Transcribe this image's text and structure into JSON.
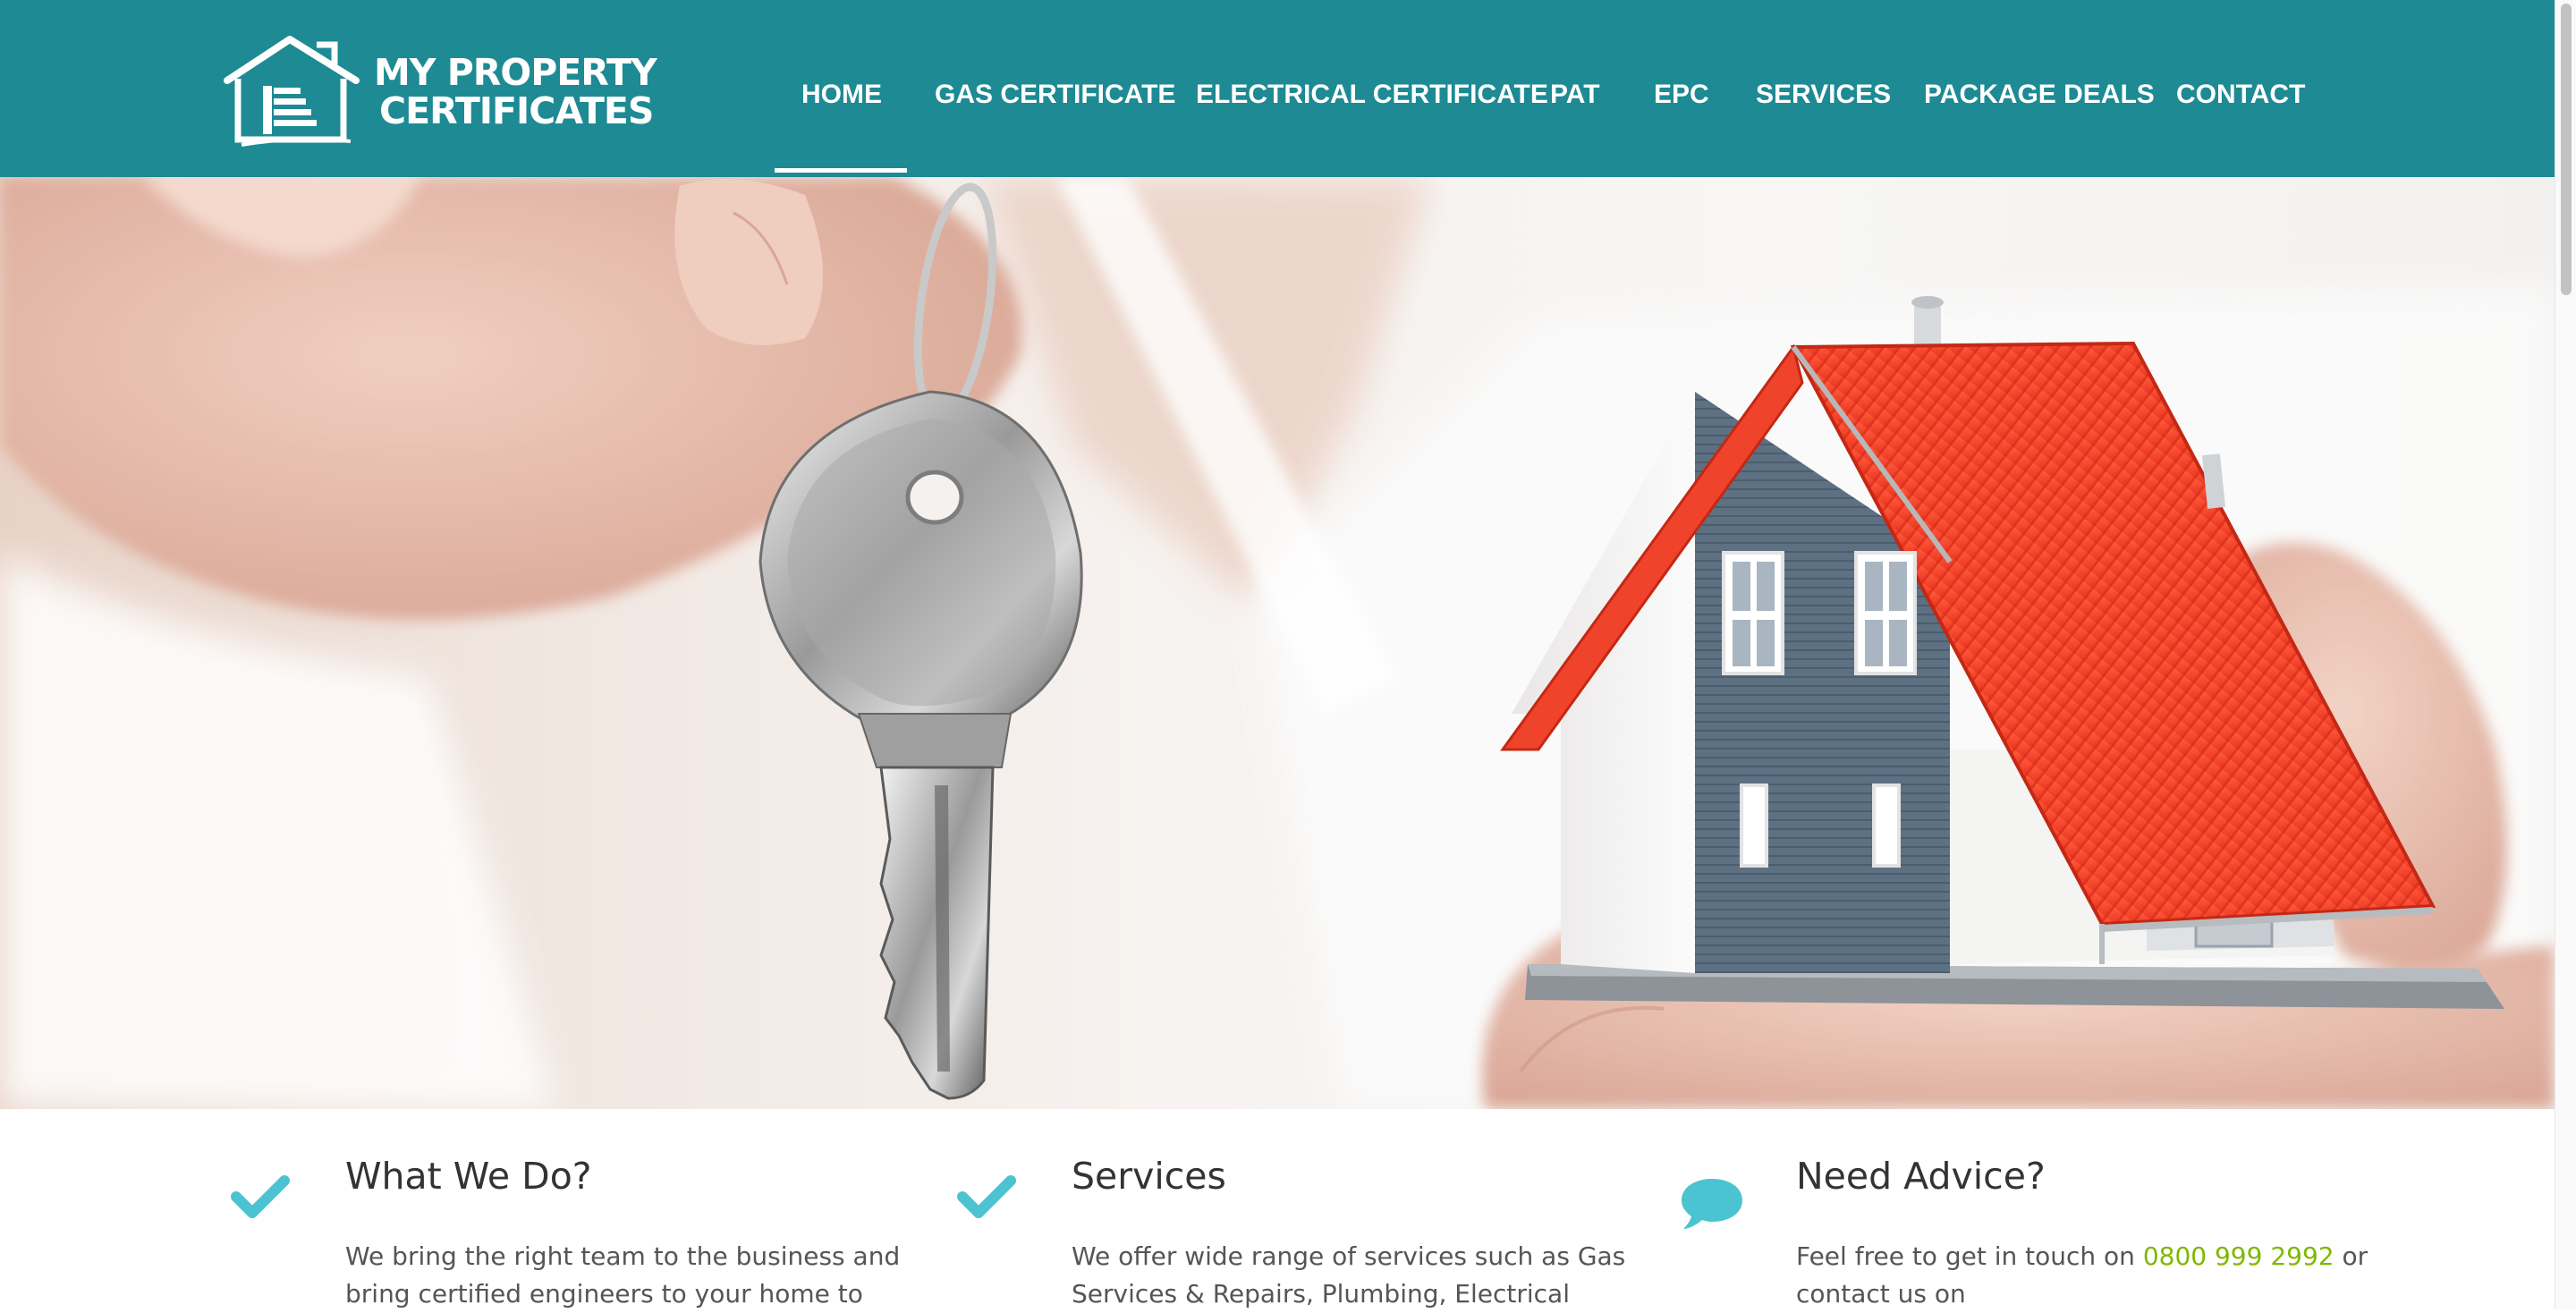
{
  "logo": {
    "line1": "MY PROPERTY",
    "line2": "CERTIFICATES",
    "icon": "house-logo-icon"
  },
  "nav": {
    "items": [
      {
        "label": "HOME",
        "active": true
      },
      {
        "label": "GAS CERTIFICATE"
      },
      {
        "label": "ELECTRICAL CERTIFICATE"
      },
      {
        "label": "PAT"
      },
      {
        "label": "EPC"
      },
      {
        "label": "SERVICES"
      },
      {
        "label": "PACKAGE DEALS"
      },
      {
        "label": "CONTACT"
      }
    ]
  },
  "hero": {
    "image": "hand-holding-key-and-model-house"
  },
  "features": [
    {
      "icon": "checkmark-icon",
      "title": "What We Do?",
      "text": [
        "We bring the right team to the business and",
        "bring certified engineers to your home to"
      ]
    },
    {
      "icon": "checkmark-icon",
      "title": "Services",
      "text": [
        "We offer wide range of services such as Gas",
        "Services & Repairs, Plumbing, Electrical"
      ]
    },
    {
      "icon": "speech-bubble-icon",
      "title": "Need Advice?",
      "text_before": "Feel free to get in touch on ",
      "phone": "0800 999 2992",
      "text_after": " or",
      "text2": "contact us on"
    }
  ],
  "colors": {
    "header_bg": "#1d8a94",
    "icon_accent": "#4cc3d1",
    "phone_link": "#7fb800",
    "roof": "#f0432c",
    "house_siding": "#5d7183"
  }
}
